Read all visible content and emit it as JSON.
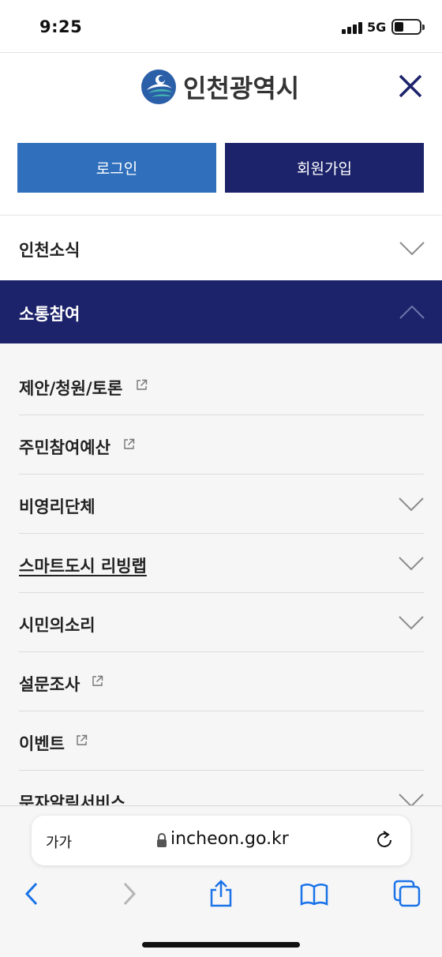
{
  "status": {
    "time": "9:25",
    "network": "5G"
  },
  "header": {
    "logo_text": "인천광역시"
  },
  "auth": {
    "login_label": "로그인",
    "join_label": "회원가입"
  },
  "menu": {
    "top_item": "인천소식",
    "active_item": "소통참여",
    "sub_items": [
      {
        "label": "제안/청원/토론",
        "type": "external"
      },
      {
        "label": "주민참여예산",
        "type": "external"
      },
      {
        "label": "비영리단체",
        "type": "expand"
      },
      {
        "label": "스마트도시 리빙랩",
        "type": "expand"
      },
      {
        "label": "시민의소리",
        "type": "expand"
      },
      {
        "label": "설문조사",
        "type": "external"
      },
      {
        "label": "이벤트",
        "type": "external"
      },
      {
        "label": "문자알림서비스",
        "type": "expand"
      }
    ]
  },
  "browser": {
    "text_size_label": "가가",
    "url": "incheon.go.kr"
  },
  "colors": {
    "login_button": "#2f6fbc",
    "join_button": "#1c236a",
    "active_menu": "#1c236a",
    "browser_accent": "#1a73e8"
  }
}
